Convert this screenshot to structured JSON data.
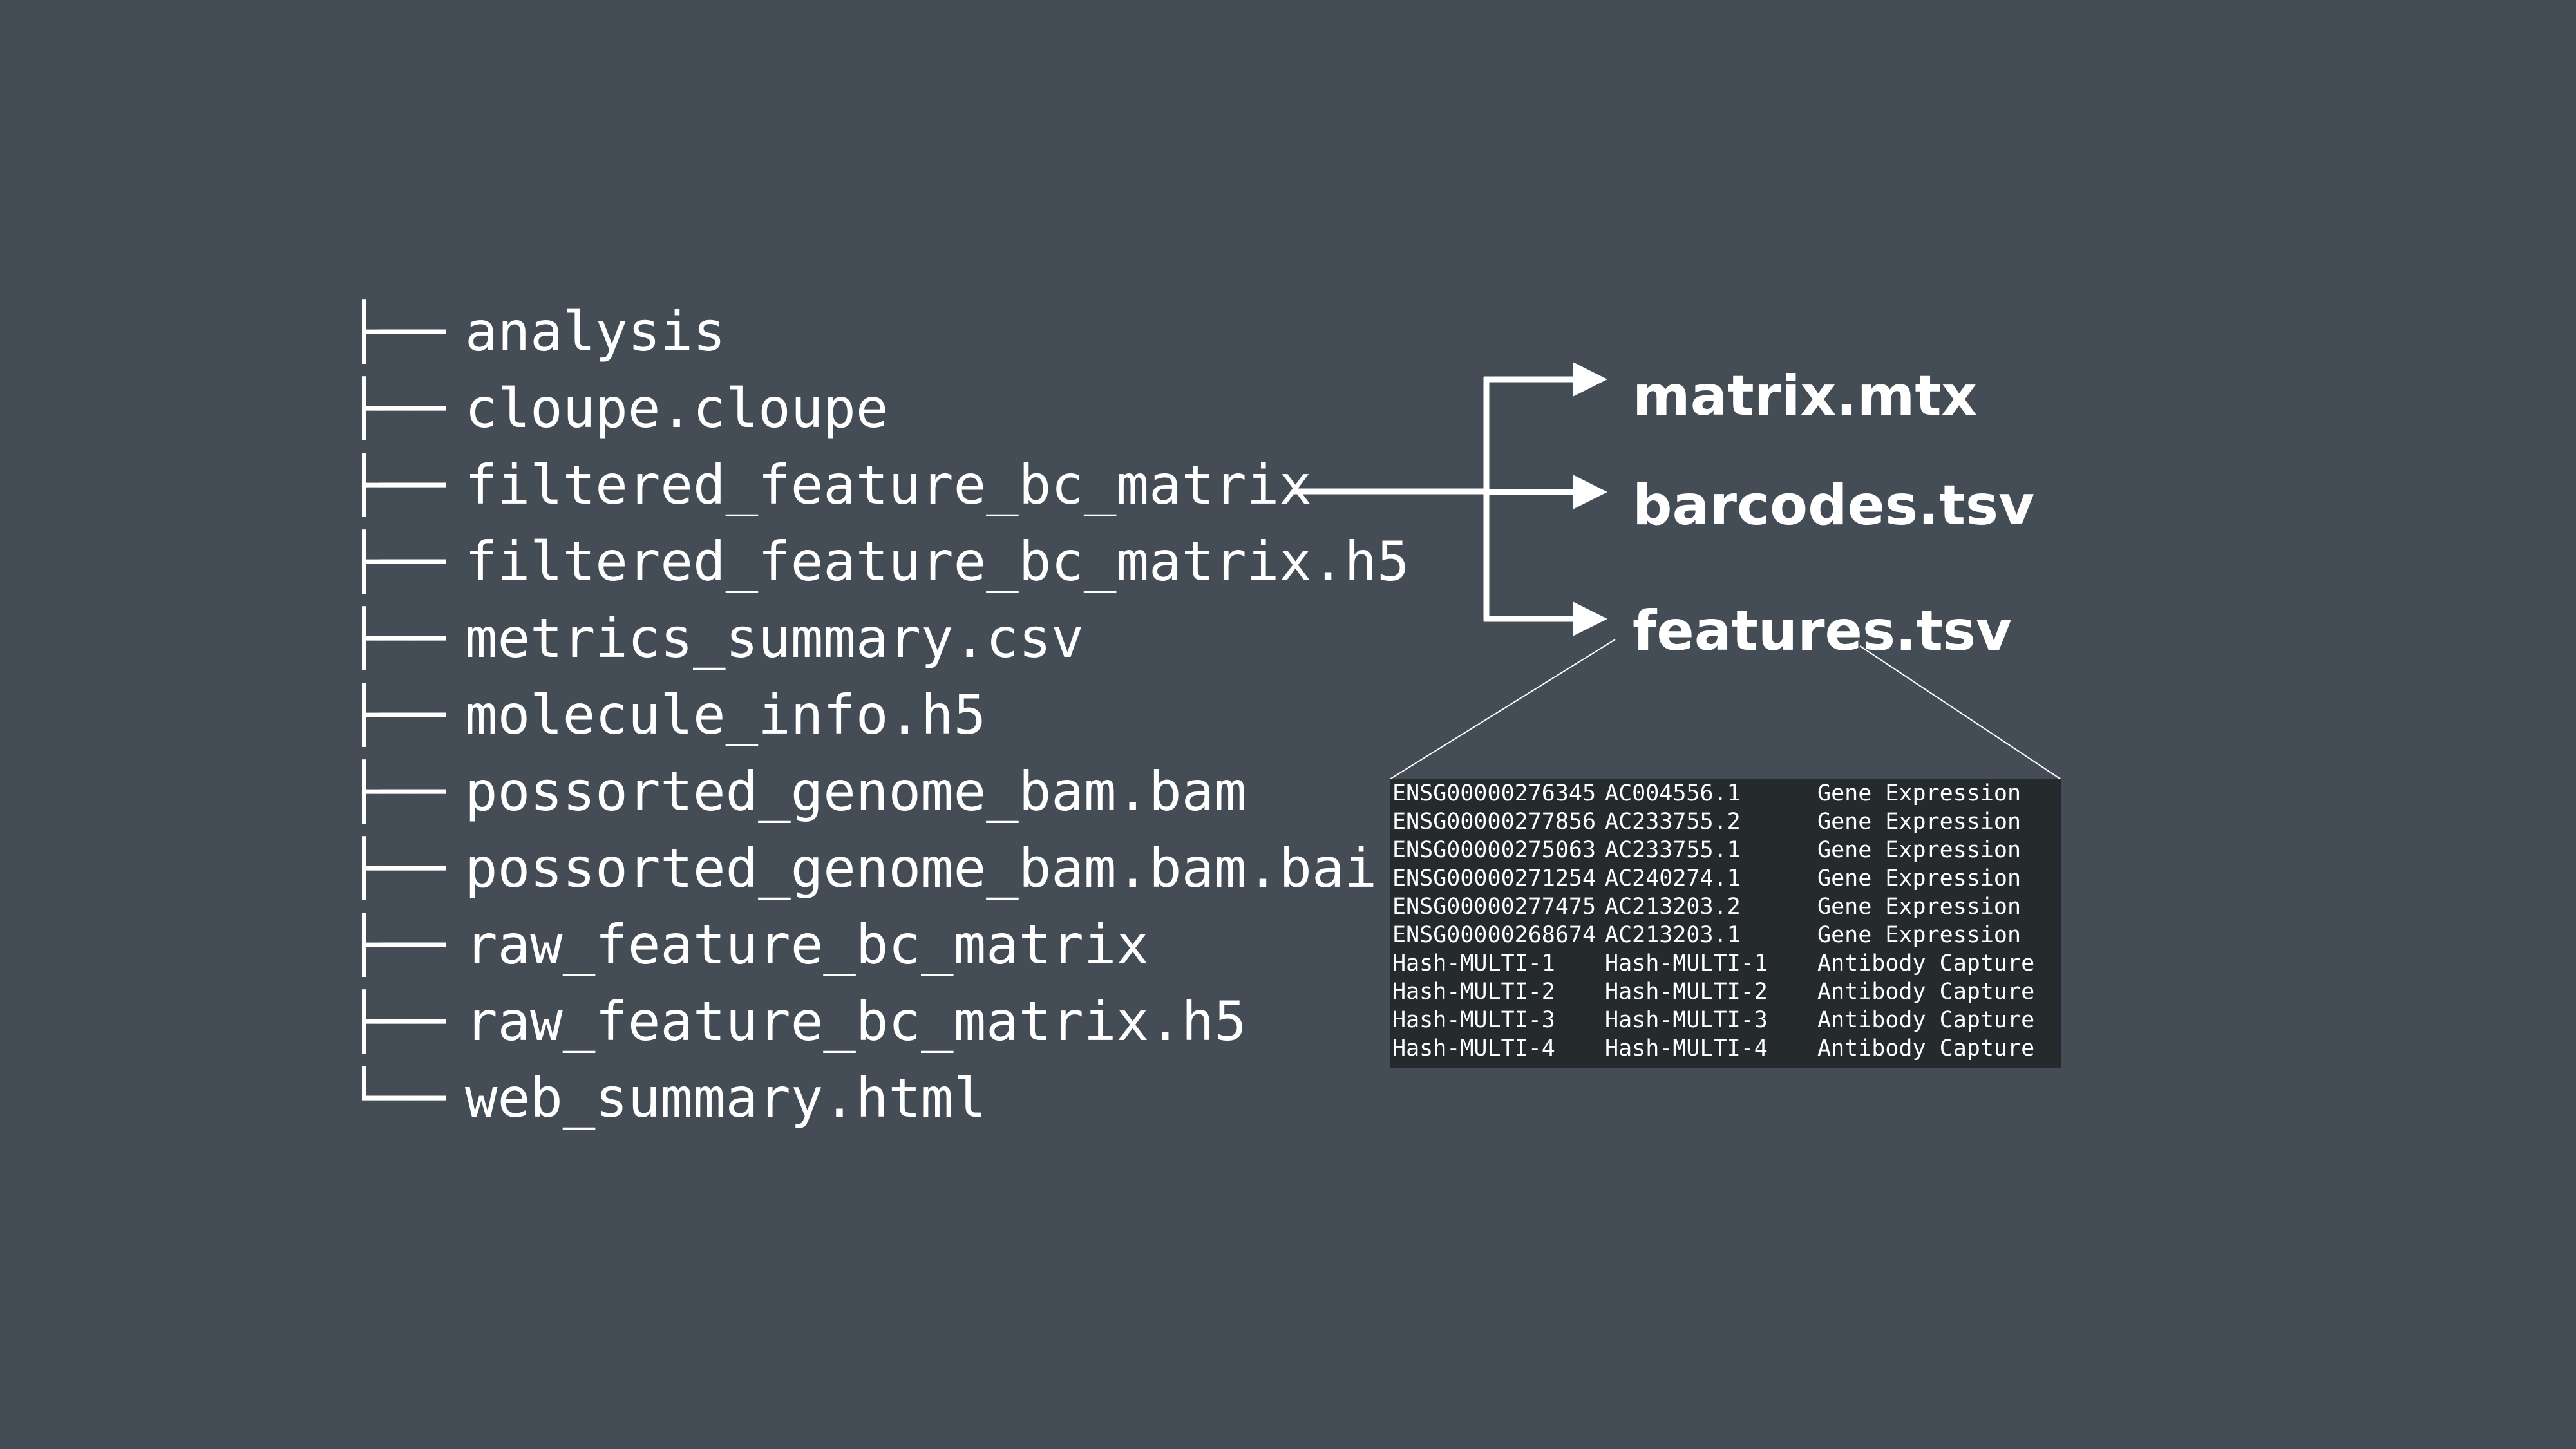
{
  "tree": {
    "items": [
      {
        "branch": "├──",
        "label": "analysis"
      },
      {
        "branch": "├──",
        "label": "cloupe.cloupe"
      },
      {
        "branch": "├──",
        "label": "filtered_feature_bc_matrix"
      },
      {
        "branch": "├──",
        "label": "filtered_feature_bc_matrix.h5"
      },
      {
        "branch": "├──",
        "label": "metrics_summary.csv"
      },
      {
        "branch": "├──",
        "label": "molecule_info.h5"
      },
      {
        "branch": "├──",
        "label": "possorted_genome_bam.bam"
      },
      {
        "branch": "├──",
        "label": "possorted_genome_bam.bam.bai"
      },
      {
        "branch": "├──",
        "label": "raw_feature_bc_matrix"
      },
      {
        "branch": "├──",
        "label": "raw_feature_bc_matrix.h5"
      },
      {
        "branch": "└──",
        "label": "web_summary.html"
      }
    ]
  },
  "outputs": {
    "matrix": "matrix.mtx",
    "barcodes": "barcodes.tsv",
    "features": "features.tsv"
  },
  "features_table": {
    "rows": [
      [
        "ENSG00000276345",
        "AC004556.1",
        "Gene Expression"
      ],
      [
        "ENSG00000277856",
        "AC233755.2",
        "Gene Expression"
      ],
      [
        "ENSG00000275063",
        "AC233755.1",
        "Gene Expression"
      ],
      [
        "ENSG00000271254",
        "AC240274.1",
        "Gene Expression"
      ],
      [
        "ENSG00000277475",
        "AC213203.2",
        "Gene Expression"
      ],
      [
        "ENSG00000268674",
        "AC213203.1",
        "Gene Expression"
      ],
      [
        "Hash-MULTI-1",
        "Hash-MULTI-1",
        "Antibody Capture"
      ],
      [
        "Hash-MULTI-2",
        "Hash-MULTI-2",
        "Antibody Capture"
      ],
      [
        "Hash-MULTI-3",
        "Hash-MULTI-3",
        "Antibody Capture"
      ],
      [
        "Hash-MULTI-4",
        "Hash-MULTI-4",
        "Antibody Capture"
      ]
    ]
  },
  "colors": {
    "background": "#444d56",
    "text": "#ffffff",
    "table_background": "#252b2c"
  }
}
